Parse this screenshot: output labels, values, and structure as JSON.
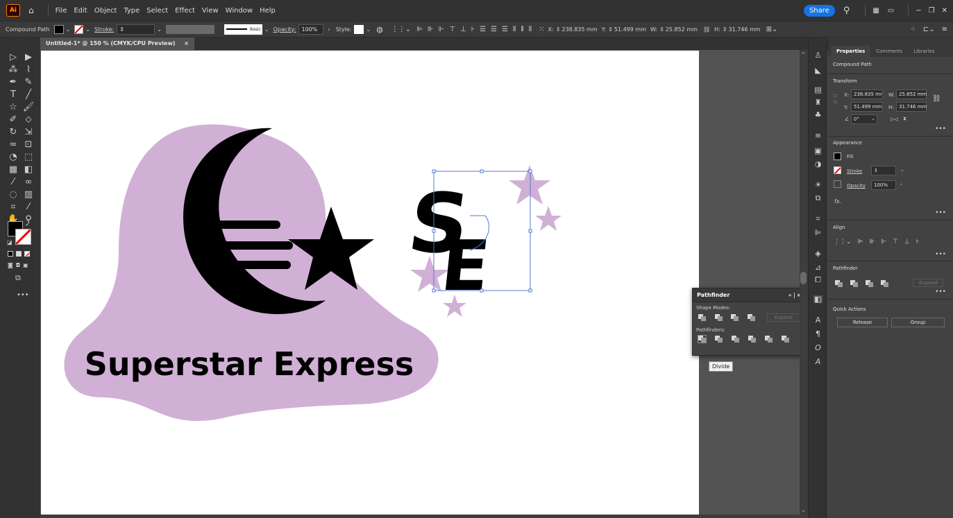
{
  "app": {
    "logo": "Ai"
  },
  "menu": [
    "File",
    "Edit",
    "Object",
    "Type",
    "Select",
    "Effect",
    "View",
    "Window",
    "Help"
  ],
  "titlebar": {
    "share_label": "Share"
  },
  "control_bar": {
    "object_type": "Compound Path",
    "stroke_label": "Stroke:",
    "brush_label": "Basic",
    "opacity_label": "Opacity:",
    "opacity_value": "100%",
    "style_label": "Style:",
    "x_label": "X:",
    "x_value": "238.835 mm",
    "y_label": "Y:",
    "y_value": "51.499 mm",
    "w_label": "W:",
    "w_value": "25.852 mm",
    "h_label": "H:",
    "h_value": "31.746 mm"
  },
  "document_tab": {
    "title": "Untitled-1* @ 150 % (CMYK/CPU Preview)",
    "close": "×"
  },
  "artwork": {
    "logo_text": "Superstar Express",
    "monogram_s": "S",
    "monogram_e": "E",
    "blob_color": "#d1b0d6",
    "ink_color": "#000000"
  },
  "pathfinder": {
    "title": "Pathfinder",
    "shape_modes_label": "Shape Modes:",
    "expand_label": "Expand",
    "pathfinders_label": "Pathfinders:",
    "tooltip": "Divide"
  },
  "properties": {
    "tabs": [
      "Properties",
      "Comments",
      "Libraries"
    ],
    "object_type": "Compound Path",
    "transform": {
      "title": "Transform",
      "x_label": "X:",
      "x_value": "238.835 mr",
      "y_label": "Y:",
      "y_value": "51.499 mm",
      "w_label": "W:",
      "w_value": "25.852 mm",
      "h_label": "H:",
      "h_value": "31.746 mm",
      "angle_value": "0°"
    },
    "appearance": {
      "title": "Appearance",
      "fill_label": "Fill",
      "stroke_label": "Stroke",
      "opacity_label": "Opacity",
      "opacity_value": "100%",
      "fx_label": "fx."
    },
    "align_title": "Align",
    "pathfinder_title": "Pathfinder",
    "pathfinder_expand": "Expand",
    "quick_actions": {
      "title": "Quick Actions",
      "release_label": "Release",
      "group_label": "Group"
    }
  }
}
